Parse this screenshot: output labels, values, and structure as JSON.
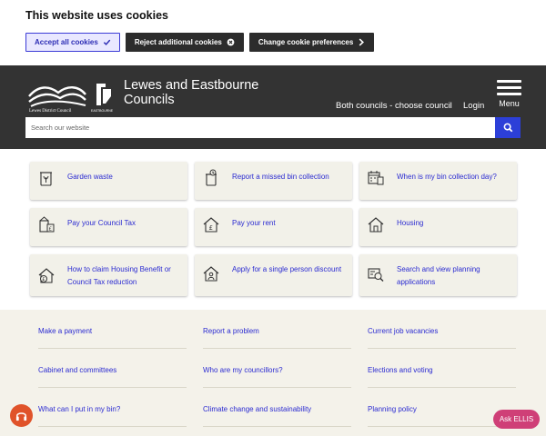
{
  "cookie": {
    "title": "This website uses cookies",
    "accept_label": "Accept all cookies",
    "reject_label": "Reject additional cookies",
    "change_label": "Change cookie preferences"
  },
  "header": {
    "site_name_line1": "Lewes and Eastbourne",
    "site_name_line2": "Councils",
    "logo_lewes_text": "Lewes District Council",
    "logo_eastbourne_text": "EASTBOURNE",
    "both_councils": "Both councils - choose council",
    "login": "Login",
    "menu": "Menu",
    "search_placeholder": "Search our website"
  },
  "tiles": [
    {
      "label": "Garden waste",
      "icon": "garden-waste-bin-icon"
    },
    {
      "label": "Report a missed bin collection",
      "icon": "missed-bin-icon"
    },
    {
      "label": "When is my bin collection day?",
      "icon": "calendar-bin-icon"
    },
    {
      "label": "Pay your Council Tax",
      "icon": "council-tax-icon"
    },
    {
      "label": "Pay your rent",
      "icon": "house-pound-icon"
    },
    {
      "label": "Housing",
      "icon": "house-icon"
    },
    {
      "label": "How to claim Housing Benefit or Council Tax reduction",
      "icon": "housing-benefit-icon"
    },
    {
      "label": "Apply for a single person discount",
      "icon": "single-person-house-icon"
    },
    {
      "label": "Search and view planning applications",
      "icon": "planning-search-icon"
    }
  ],
  "links": [
    "Make a payment",
    "Report a problem",
    "Current job vacancies",
    "Cabinet and committees",
    "Who are my councillors?",
    "Elections and voting",
    "What can I put in my bin?",
    "Climate change and sustainability",
    "Planning policy"
  ],
  "widgets": {
    "ask_ellis": "Ask ELLIS",
    "accessibility_icon": "headphones-icon"
  },
  "colors": {
    "link": "#2b2bd1",
    "header_bg": "#333333",
    "search_button": "#2c3fd8",
    "ellis": "#cf3f77",
    "accessibility": "#e0532a"
  }
}
